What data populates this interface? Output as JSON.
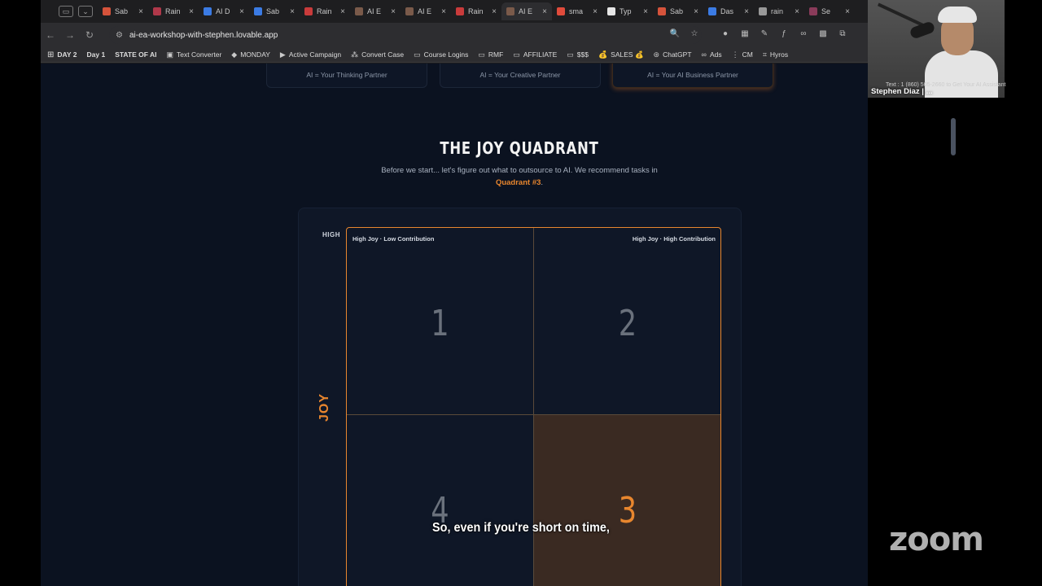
{
  "browser": {
    "tabs": [
      {
        "title": "Sab",
        "color": "#d5533b"
      },
      {
        "title": "Rain",
        "color": "#b0384a"
      },
      {
        "title": "AI D",
        "color": "#3b7be4"
      },
      {
        "title": "Sab",
        "color": "#3b7be4"
      },
      {
        "title": "Rain",
        "color": "#c93b3b"
      },
      {
        "title": "AI E",
        "color": "#7a5a4a"
      },
      {
        "title": "AI E",
        "color": "#7a5a4a"
      },
      {
        "title": "Rain",
        "color": "#c93b3b"
      },
      {
        "title": "AI E",
        "color": "#7a5a4a",
        "active": true
      },
      {
        "title": "sma",
        "color": "#e04b3b"
      },
      {
        "title": "Typ",
        "color": "#e6e6e6"
      },
      {
        "title": "Sab",
        "color": "#d5533b"
      },
      {
        "title": "Das",
        "color": "#3b7be4"
      },
      {
        "title": "rain",
        "color": "#999999"
      },
      {
        "title": "Se",
        "color": "#8a3b5a"
      }
    ],
    "url": "ai-ea-workshop-with-stephen.lovable.app",
    "bookmarks": [
      {
        "label": "DAY 2",
        "bold": true
      },
      {
        "label": "Day 1",
        "bold": true
      },
      {
        "label": "STATE OF AI",
        "bold": true
      },
      {
        "label": "Text Converter",
        "icon": "▣"
      },
      {
        "label": "MONDAY",
        "icon": "◆"
      },
      {
        "label": "Active Campaign",
        "icon": "▶"
      },
      {
        "label": "Convert Case",
        "icon": "⁂"
      },
      {
        "label": "Course Logins",
        "icon": "▭"
      },
      {
        "label": "RMF",
        "icon": "▭"
      },
      {
        "label": "AFFILIATE",
        "icon": "▭"
      },
      {
        "label": "$$$",
        "icon": "▭"
      },
      {
        "label": "SALES 💰",
        "icon": "💰"
      },
      {
        "label": "ChatGPT",
        "icon": "⊛"
      },
      {
        "label": "Ads",
        "icon": "∞"
      },
      {
        "label": "CM",
        "icon": "⋮"
      },
      {
        "label": "Hyros",
        "icon": "⌗"
      }
    ]
  },
  "partners": [
    "AI = Your Thinking Partner",
    "AI = Your Creative Partner",
    "AI = Your AI Business Partner"
  ],
  "section": {
    "title": "THE JOY QUADRANT",
    "intro_line1": "Before we start... let's figure out what to outsource to AI. We recommend tasks in",
    "intro_accent": "Quadrant #3",
    "intro_end": "."
  },
  "quadrant": {
    "axis_high": "HIGH",
    "axis_joy": "JOY",
    "q1_label": "High Joy · Low Contribution",
    "q2_label": "High Joy · High Contribution",
    "q1": "1",
    "q2": "2",
    "q3": "3",
    "q4": "4"
  },
  "overlay": {
    "caption": "So, even if you're short on time,",
    "zoom_logo": "zoom",
    "participant_name": "Stephen Diaz | ...",
    "participant_ticker": "Text : 1 (860) 505-2660 to Get Your AI Assistant"
  },
  "colors": {
    "accent": "#e8862e",
    "page_bg": "#0b1220",
    "quadrant3_bg": "#3a2a22"
  }
}
